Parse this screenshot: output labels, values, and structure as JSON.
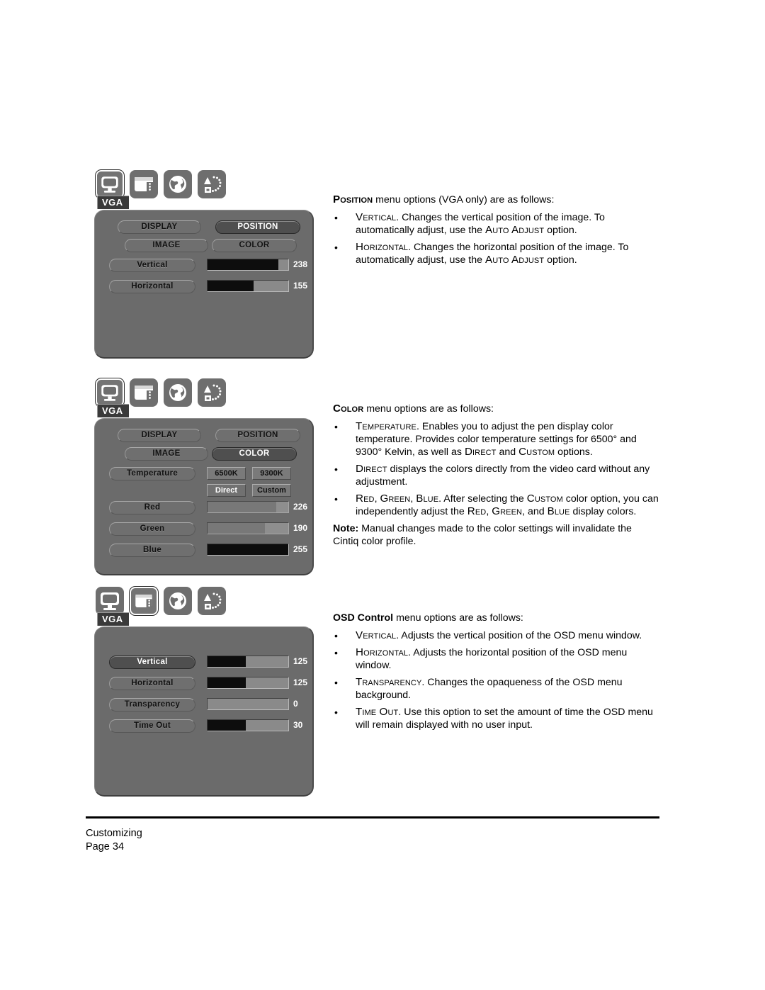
{
  "page": {
    "footer_line1": "Customizing",
    "footer_line2": "Page  34",
    "background_color": "#ffffff"
  },
  "colors": {
    "panel_bg": "#6b6b6b",
    "icon_bg": "#6e6e6e",
    "bar_fill": "#0d0d0d",
    "bar_track": "#8a8a8a",
    "selected_pill_bg": "#4f4f4f",
    "badge_bg": "#3a3a3a"
  },
  "osd_panels": [
    {
      "id": "position-menu",
      "icons": [
        {
          "name": "monitor-icon",
          "selected": true
        },
        {
          "name": "osd-window-icon",
          "selected": false
        },
        {
          "name": "globe-icon",
          "selected": false
        },
        {
          "name": "shapes-dots-icon",
          "selected": false
        }
      ],
      "badge": "VGA",
      "tabs": [
        {
          "label": "DISPLAY",
          "selected": false
        },
        {
          "label": "POSITION",
          "selected": true
        },
        {
          "label": "IMAGE",
          "selected": false
        },
        {
          "label": "COLOR",
          "selected": false
        }
      ],
      "sliders": [
        {
          "label": "Vertical",
          "value": "238",
          "percent": 88,
          "dim": false,
          "selected": false
        },
        {
          "label": "Horizontal",
          "value": "155",
          "percent": 57,
          "dim": false,
          "selected": false
        }
      ]
    },
    {
      "id": "color-menu",
      "icons": [
        {
          "name": "monitor-icon",
          "selected": true
        },
        {
          "name": "osd-window-icon",
          "selected": false
        },
        {
          "name": "globe-icon",
          "selected": false
        },
        {
          "name": "shapes-dots-icon",
          "selected": false
        }
      ],
      "badge": "VGA",
      "tabs": [
        {
          "label": "DISPLAY",
          "selected": false
        },
        {
          "label": "POSITION",
          "selected": false
        },
        {
          "label": "IMAGE",
          "selected": false
        },
        {
          "label": "COLOR",
          "selected": true
        }
      ],
      "temperature": {
        "label": "Temperature",
        "options": [
          {
            "label": "6500K",
            "selected": false
          },
          {
            "label": "9300K",
            "selected": false
          },
          {
            "label": "Direct",
            "selected": true
          },
          {
            "label": "Custom",
            "selected": false
          }
        ]
      },
      "sliders": [
        {
          "label": "Red",
          "value": "226",
          "percent": 85,
          "dim": true,
          "selected": false
        },
        {
          "label": "Green",
          "value": "190",
          "percent": 71,
          "dim": true,
          "selected": false
        },
        {
          "label": "Blue",
          "value": "255",
          "percent": 100,
          "dim": false,
          "selected": false
        }
      ]
    },
    {
      "id": "osd-control-menu",
      "icons": [
        {
          "name": "monitor-icon",
          "selected": false
        },
        {
          "name": "osd-window-icon",
          "selected": true
        },
        {
          "name": "globe-icon",
          "selected": false
        },
        {
          "name": "shapes-dots-icon",
          "selected": false
        }
      ],
      "badge": "VGA",
      "sliders": [
        {
          "label": "Vertical",
          "value": "125",
          "percent": 47,
          "dim": false,
          "selected": true
        },
        {
          "label": "Horizontal",
          "value": "125",
          "percent": 47,
          "dim": false,
          "selected": false
        },
        {
          "label": "Transparency",
          "value": "0",
          "percent": 0,
          "dim": false,
          "selected": false
        },
        {
          "label": "Time Out",
          "value": "30",
          "percent": 47,
          "dim": false,
          "selected": false
        }
      ]
    }
  ],
  "text_blocks": [
    {
      "id": "position-text",
      "lead_html": "<span class=\"sc b\">Position</span> menu options (VGA only) are as follows:",
      "bullets": [
        "<span class=\"sc\">Vertical</span>.  Changes the vertical position of the image. To automatically adjust, use the <span class=\"sc\">Auto Adjust</span> option.",
        "<span class=\"sc\">Horizontal</span>.  Changes the horizontal position of the image. To automatically adjust, use the <span class=\"sc\">Auto Adjust</span> option."
      ],
      "note_html": ""
    },
    {
      "id": "color-text",
      "lead_html": "<span class=\"sc b\">Color</span> menu options are as follows:",
      "bullets": [
        "<span class=\"sc\">Temperature</span>.  Enables you to adjust the pen display color temperature.  Provides color temperature settings for 6500&deg; and 9300&deg; Kelvin, as well as <span class=\"sc\">Direct</span> and <span class=\"sc\">Custom</span> options.",
        "<span class=\"sc\">Direct</span> displays the colors directly from the video card without any adjustment.",
        "<span class=\"sc\">Red</span>, <span class=\"sc\">Green</span>, <span class=\"sc\">Blue</span>.  After selecting the <span class=\"sc\">Custom</span> color option, you can independently adjust the <span class=\"sc\">Red</span>, <span class=\"sc\">Green</span>, and <span class=\"sc\">Blue</span> display colors."
      ],
      "note_html": "<span class=\"b\">Note:</span> Manual changes made to the color settings will invalidate the Cintiq color profile."
    },
    {
      "id": "osd-control-text",
      "lead_html": "<span class=\"b\">OSD Control</span> menu options are as follows:",
      "bullets": [
        "<span class=\"sc\">Vertical</span>.  Adjusts the vertical position of the OSD menu window.",
        "<span class=\"sc\">Horizontal</span>.  Adjusts the horizontal position of the OSD menu window.",
        "<span class=\"sc\">Transparency</span>.  Changes the opaqueness of the OSD menu background.",
        "<span class=\"sc\">Time Out</span>.  Use this option to set the amount of time the OSD menu will remain displayed with no user input."
      ],
      "note_html": ""
    }
  ],
  "bullet_glyph": "•"
}
